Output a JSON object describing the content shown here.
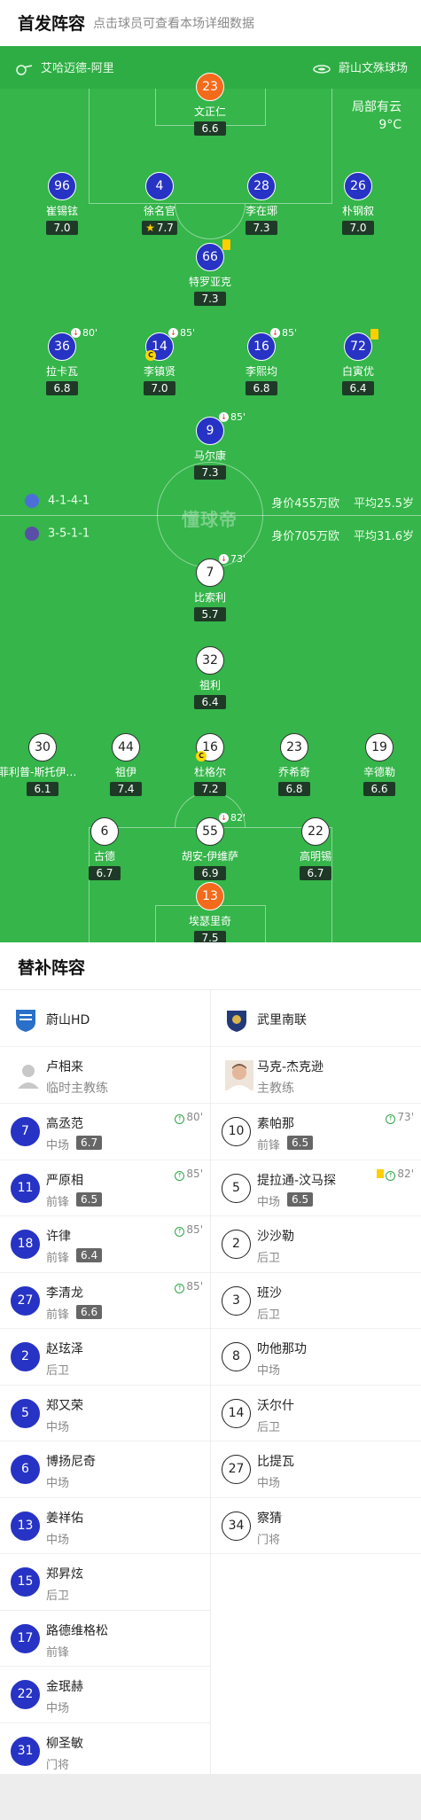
{
  "header": {
    "title": "首发阵容",
    "subtitle": "点击球员可查看本场详细数据"
  },
  "pitch": {
    "away_team": "艾哈迈德-阿里",
    "home_team": "蔚山文殊球场",
    "weather": [
      "局部有云",
      "9°C"
    ],
    "watermark": "懂球帝",
    "away_formation": "4-1-4-1",
    "home_formation": "3-5-1-1",
    "away_value": "身价455万欧",
    "away_age": "平均25.5岁",
    "home_value": "身价705万欧",
    "home_age": "平均31.6岁",
    "colors": {
      "pitch": "#35b54a",
      "home": "#2733c4",
      "keeper": "#f46a1b"
    }
  },
  "home_players": [
    {
      "num": "23",
      "name": "文正仁",
      "rating": "6.6",
      "gk": true
    },
    {
      "num": "96",
      "name": "崔锡铉",
      "rating": "7.0"
    },
    {
      "num": "4",
      "name": "徐名官",
      "rating": "7.7",
      "star": true
    },
    {
      "num": "28",
      "name": "李在琊",
      "rating": "7.3"
    },
    {
      "num": "26",
      "name": "朴钢叙",
      "rating": "7.0"
    },
    {
      "num": "66",
      "name": "特罗亚克",
      "rating": "7.3",
      "yellow": true
    },
    {
      "num": "36",
      "name": "拉卡瓦",
      "rating": "6.8",
      "sub": "80'"
    },
    {
      "num": "14",
      "name": "李镇贤",
      "rating": "7.0",
      "sub": "85'",
      "captain": true
    },
    {
      "num": "16",
      "name": "李熙均",
      "rating": "6.8",
      "sub": "85'"
    },
    {
      "num": "72",
      "name": "白寅优",
      "rating": "6.4",
      "yellow": true
    },
    {
      "num": "9",
      "name": "马尔康",
      "rating": "7.3",
      "sub": "85'"
    }
  ],
  "away_players": [
    {
      "num": "7",
      "name": "比索利",
      "rating": "5.7",
      "sub": "73'"
    },
    {
      "num": "32",
      "name": "祖利",
      "rating": "6.4"
    },
    {
      "num": "30",
      "name": "菲利普-斯托伊科维奇",
      "rating": "6.1"
    },
    {
      "num": "44",
      "name": "祖伊",
      "rating": "7.4"
    },
    {
      "num": "16",
      "name": "杜格尔",
      "rating": "7.2",
      "captain": true
    },
    {
      "num": "23",
      "name": "乔希奇",
      "rating": "6.8"
    },
    {
      "num": "19",
      "name": "辛德勒",
      "rating": "6.6"
    },
    {
      "num": "6",
      "name": "古德",
      "rating": "6.7"
    },
    {
      "num": "55",
      "name": "胡安-伊维萨",
      "rating": "6.9",
      "sub": "82'"
    },
    {
      "num": "22",
      "name": "高明锡",
      "rating": "6.7"
    },
    {
      "num": "13",
      "name": "埃瑟里奇",
      "rating": "7.5",
      "gk": true
    }
  ],
  "subs": {
    "title": "替补阵容",
    "home": {
      "team": "蔚山HD",
      "coach": "卢相来",
      "coach_role": "临时主教练",
      "players": [
        {
          "num": "7",
          "name": "高丞范",
          "pos": "中场",
          "rating": "6.7",
          "min": "80'"
        },
        {
          "num": "11",
          "name": "严原相",
          "pos": "前锋",
          "rating": "6.5",
          "min": "85'"
        },
        {
          "num": "18",
          "name": "许律",
          "pos": "前锋",
          "rating": "6.4",
          "min": "85'"
        },
        {
          "num": "27",
          "name": "李清龙",
          "pos": "前锋",
          "rating": "6.6",
          "min": "85'"
        },
        {
          "num": "2",
          "name": "赵玹泽",
          "pos": "后卫"
        },
        {
          "num": "5",
          "name": "郑又荣",
          "pos": "中场"
        },
        {
          "num": "6",
          "name": "博扬尼奇",
          "pos": "中场"
        },
        {
          "num": "13",
          "name": "姜祥佑",
          "pos": "中场"
        },
        {
          "num": "15",
          "name": "郑昇炫",
          "pos": "后卫"
        },
        {
          "num": "17",
          "name": "路德维格松",
          "pos": "前锋"
        },
        {
          "num": "22",
          "name": "金珉赫",
          "pos": "中场"
        },
        {
          "num": "31",
          "name": "柳圣敏",
          "pos": "门将"
        }
      ]
    },
    "away": {
      "team": "武里南联",
      "coach": "马克-杰克逊",
      "coach_role": "主教练",
      "players": [
        {
          "num": "10",
          "name": "素帕那",
          "pos": "前锋",
          "rating": "6.5",
          "min": "73'"
        },
        {
          "num": "5",
          "name": "提拉通-汶马探",
          "pos": "中场",
          "rating": "6.5",
          "min": "82'",
          "yellow": true
        },
        {
          "num": "2",
          "name": "沙沙勒",
          "pos": "后卫"
        },
        {
          "num": "3",
          "name": "班沙",
          "pos": "后卫"
        },
        {
          "num": "8",
          "name": "叻他那功",
          "pos": "中场"
        },
        {
          "num": "14",
          "name": "沃尔什",
          "pos": "后卫"
        },
        {
          "num": "27",
          "name": "比提瓦",
          "pos": "中场"
        },
        {
          "num": "34",
          "name": "察猜",
          "pos": "门将"
        }
      ]
    }
  }
}
